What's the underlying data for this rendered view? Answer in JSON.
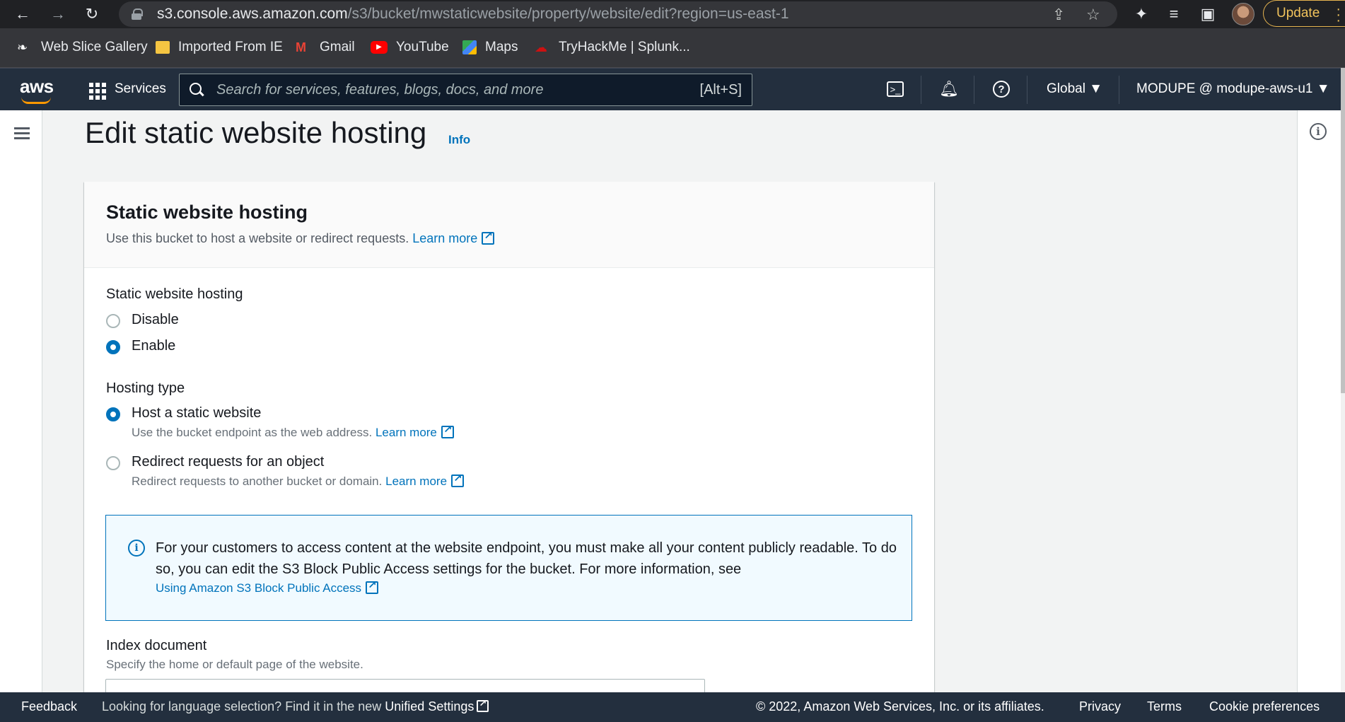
{
  "browser": {
    "url_host": "s3.console.aws.amazon.com",
    "url_path": "/s3/bucket/mwstaticwebsite/property/website/edit?region=us-east-1",
    "update_label": "Update",
    "bookmarks": [
      "Web Slice Gallery",
      "Imported From IE",
      "Gmail",
      "YouTube",
      "Maps",
      "TryHackMe | Splunk..."
    ]
  },
  "aws_nav": {
    "logo": "aws",
    "services_label": "Services",
    "search_placeholder": "Search for services, features, blogs, docs, and more",
    "search_shortcut": "[Alt+S]",
    "region": "Global ▼",
    "account": "MODUPE @ modupe-aws-u1 ▼"
  },
  "page": {
    "title": "Edit static website hosting",
    "info_link": "Info"
  },
  "panel": {
    "title": "Static website hosting",
    "description": "Use this bucket to host a website or redirect requests.",
    "learn_more": "Learn more",
    "hosting_label": "Static website hosting",
    "hosting_options": [
      {
        "label": "Disable",
        "checked": false
      },
      {
        "label": "Enable",
        "checked": true
      }
    ],
    "hosting_type_label": "Hosting type",
    "hosting_types": [
      {
        "label": "Host a static website",
        "desc": "Use the bucket endpoint as the web address.",
        "link": "Learn more",
        "checked": true
      },
      {
        "label": "Redirect requests for an object",
        "desc": "Redirect requests to another bucket or domain.",
        "link": "Learn more",
        "checked": false
      }
    ],
    "alert_text": "For your customers to access content at the website endpoint, you must make all your content publicly readable. To do so, you can edit the S3 Block Public Access settings for the bucket. For more information, see",
    "alert_link": "Using Amazon S3 Block Public Access",
    "index_label": "Index document",
    "index_desc": "Specify the home or default page of the website."
  },
  "footer": {
    "feedback": "Feedback",
    "language_prefix": "Looking for language selection? Find it in the new",
    "unified_settings": "Unified Settings",
    "copyright": "© 2022, Amazon Web Services, Inc. or its affiliates.",
    "privacy": "Privacy",
    "terms": "Terms",
    "cookie": "Cookie preferences"
  },
  "colors": {
    "aws_navy": "#232f3e",
    "link_blue": "#0073bb",
    "aws_orange": "#ff9900"
  }
}
